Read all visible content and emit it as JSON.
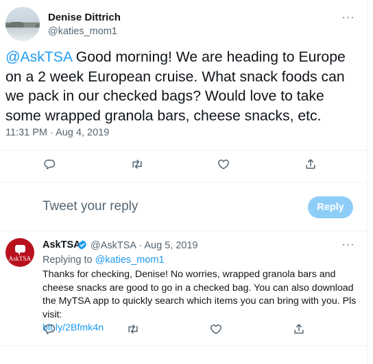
{
  "main_tweet": {
    "author_name": "Denise Dittrich",
    "author_handle": "@katies_mom1",
    "mention": "@AskTSA",
    "text": " Good morning! We are heading to Europe on a 2 week European cruise. What snack foods can we pack in our checked bags? Would love to take some wrapped granola bars, cheese snacks, etc.",
    "timestamp": "11:31 PM · Aug 4, 2019",
    "more_label": "···"
  },
  "compose": {
    "placeholder": "Tweet your reply",
    "button_label": "Reply"
  },
  "reply_tweet": {
    "author_name": "AskTSA",
    "author_handle_date": "@AskTSA · Aug 5, 2019",
    "replying_to_prefix": "Replying to ",
    "replying_to_handle": "@katies_mom1",
    "text": "Thanks for checking, Denise! No worries, wrapped granola bars and cheese snacks are good to go in a checked bag. You can also download the MyTSA app to quickly search which items you can bring with you. Pls visit:",
    "link": "bit.ly/2Bfmk4n",
    "avatar_text": "AskTSA",
    "more_label": "···"
  },
  "colors": {
    "accent": "#1d9bf0",
    "reply_button_disabled": "#8ecdf8",
    "secondary_text": "#536471",
    "asktsa_avatar": "#b8121f"
  },
  "icons": {
    "actions": [
      "reply-icon",
      "retweet-icon",
      "like-icon",
      "share-icon"
    ],
    "verified": "verified-badge-icon"
  }
}
